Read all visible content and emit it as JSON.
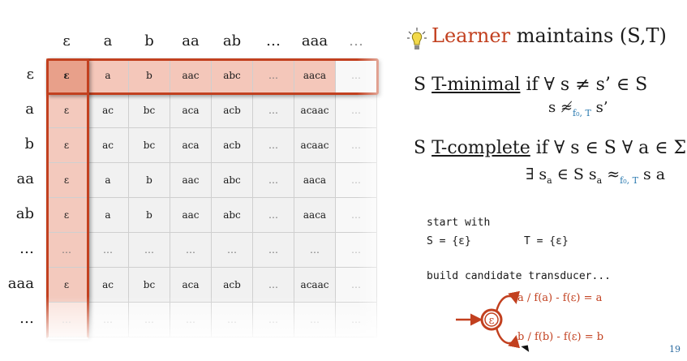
{
  "table": {
    "column_headers": [
      "ε",
      "a",
      "b",
      "aa",
      "ab",
      "…",
      "aaa",
      "…"
    ],
    "row_headers": [
      "ε",
      "a",
      "b",
      "aa",
      "ab",
      "…",
      "aaa",
      "…"
    ],
    "rows": [
      [
        "ε",
        "a",
        "b",
        "aac",
        "abc",
        "…",
        "aaca",
        "…"
      ],
      [
        "ε",
        "ac",
        "bc",
        "aca",
        "acb",
        "…",
        "acaac",
        "…"
      ],
      [
        "ε",
        "ac",
        "bc",
        "aca",
        "acb",
        "…",
        "acaac",
        "…"
      ],
      [
        "ε",
        "a",
        "b",
        "aac",
        "abc",
        "…",
        "aaca",
        "…"
      ],
      [
        "ε",
        "a",
        "b",
        "aac",
        "abc",
        "…",
        "aaca",
        "…"
      ],
      [
        "…",
        "…",
        "…",
        "…",
        "…",
        "…",
        "…",
        "…"
      ],
      [
        "ε",
        "ac",
        "bc",
        "aca",
        "acb",
        "…",
        "acaac",
        "…"
      ],
      [
        "…",
        "…",
        "…",
        "…",
        "…",
        "…",
        "…",
        "…"
      ]
    ]
  },
  "heading": {
    "accent": "Learner",
    "rest": " maintains (S,T)"
  },
  "t_minimal": {
    "prefix": "S ",
    "term": "T-minimal",
    "cond": "  if  ∀ s ≠ s’ ∈ S",
    "line2_pre": "s ≉",
    "line2_sub": "f₀, T",
    "line2_post": " s’"
  },
  "t_complete": {
    "prefix": "S ",
    "term": "T-complete",
    "cond": "  if  ∀ s ∈ S  ∀ a ∈ Σ",
    "line2_pre": "∃ s",
    "line2_sub_a": "a",
    "line2_mid": " ∈ S   s",
    "line2_sub_b": "a",
    "line2_approx": " ≈",
    "line2_sub_c": "f₀, T",
    "line2_post": " s a"
  },
  "start": {
    "label": "start with",
    "s_init": "S = {ε}",
    "t_init": "T = {ε}"
  },
  "build": {
    "label": "build candidate transducer..."
  },
  "transducer": {
    "state": "ε",
    "edge_a": "a / f(a) - f(ε) = a",
    "edge_b": "b / f(b) - f(ε) = b"
  },
  "page_number": "19",
  "colors": {
    "accent": "#c2401f",
    "subscript": "#2a7ab0",
    "cell": "#f1f1f1",
    "highlight_fill": "#f4c7ba"
  }
}
